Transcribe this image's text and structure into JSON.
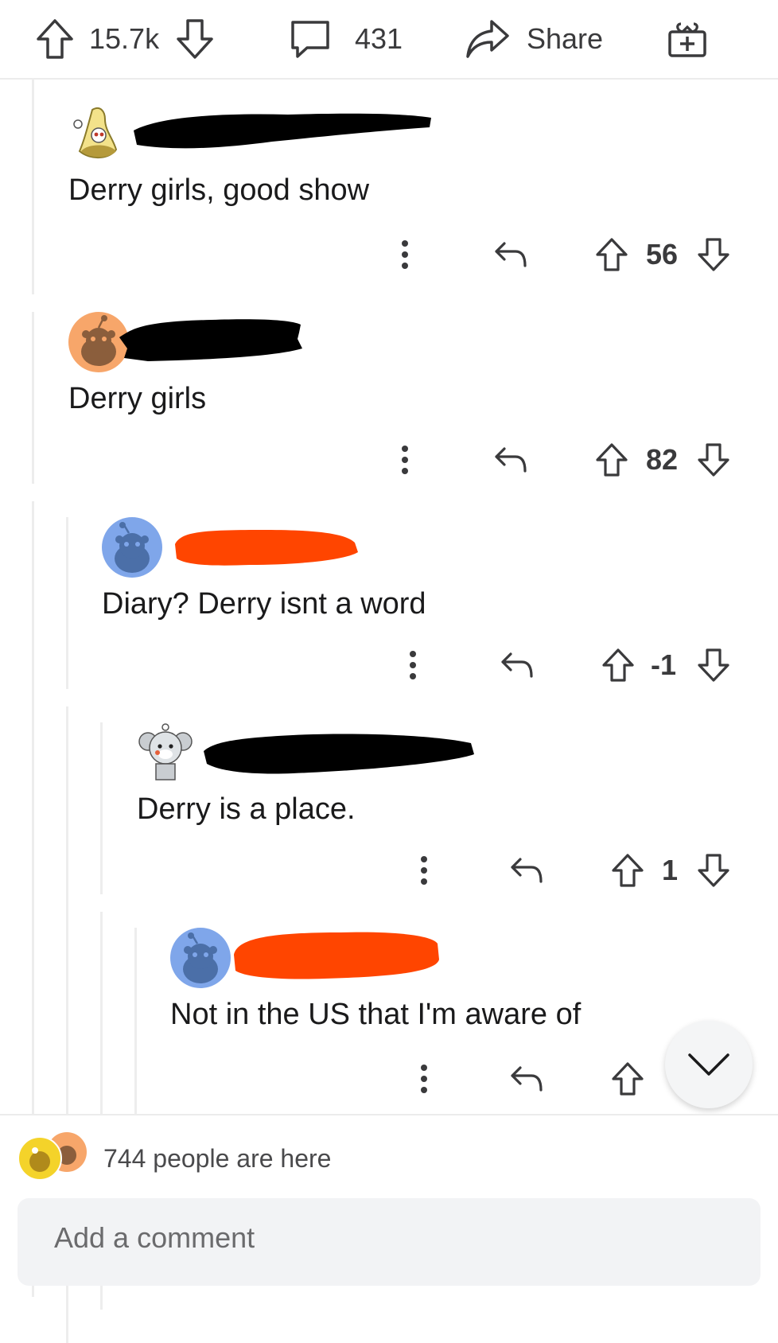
{
  "topbar": {
    "score": "15.7k",
    "comments": "431",
    "share_label": "Share",
    "icons": [
      "upvote-icon",
      "downvote-icon",
      "comment-bubble-icon",
      "share-arrow-icon",
      "gift-award-icon"
    ]
  },
  "comments": [
    {
      "text": "Derry girls, good show",
      "score": "56",
      "avatar": "banana-avatar",
      "username_redaction": "#000000"
    },
    {
      "text": "Derry girls",
      "score": "82",
      "avatar": "snoo-orange-avatar",
      "username_redaction": "#000000"
    },
    {
      "text": "Diary? Derry isnt a word",
      "score": "-1",
      "avatar": "snoo-blue-avatar",
      "username_redaction": "#ff4500"
    },
    {
      "text": "Derry is a place.",
      "score": "1",
      "avatar": "snoo-koala-avatar",
      "username_redaction": "#000000"
    },
    {
      "text": "Not in the US that I'm aware of",
      "score": "",
      "avatar": "snoo-blue-avatar",
      "username_redaction": "#ff4500"
    }
  ],
  "presence": {
    "text": "744 people are here"
  },
  "composer": {
    "placeholder": "Add a comment"
  },
  "colors": {
    "accent": "#ff4500",
    "icon_gray": "#3a3a3c",
    "thread_line": "#ededed"
  }
}
